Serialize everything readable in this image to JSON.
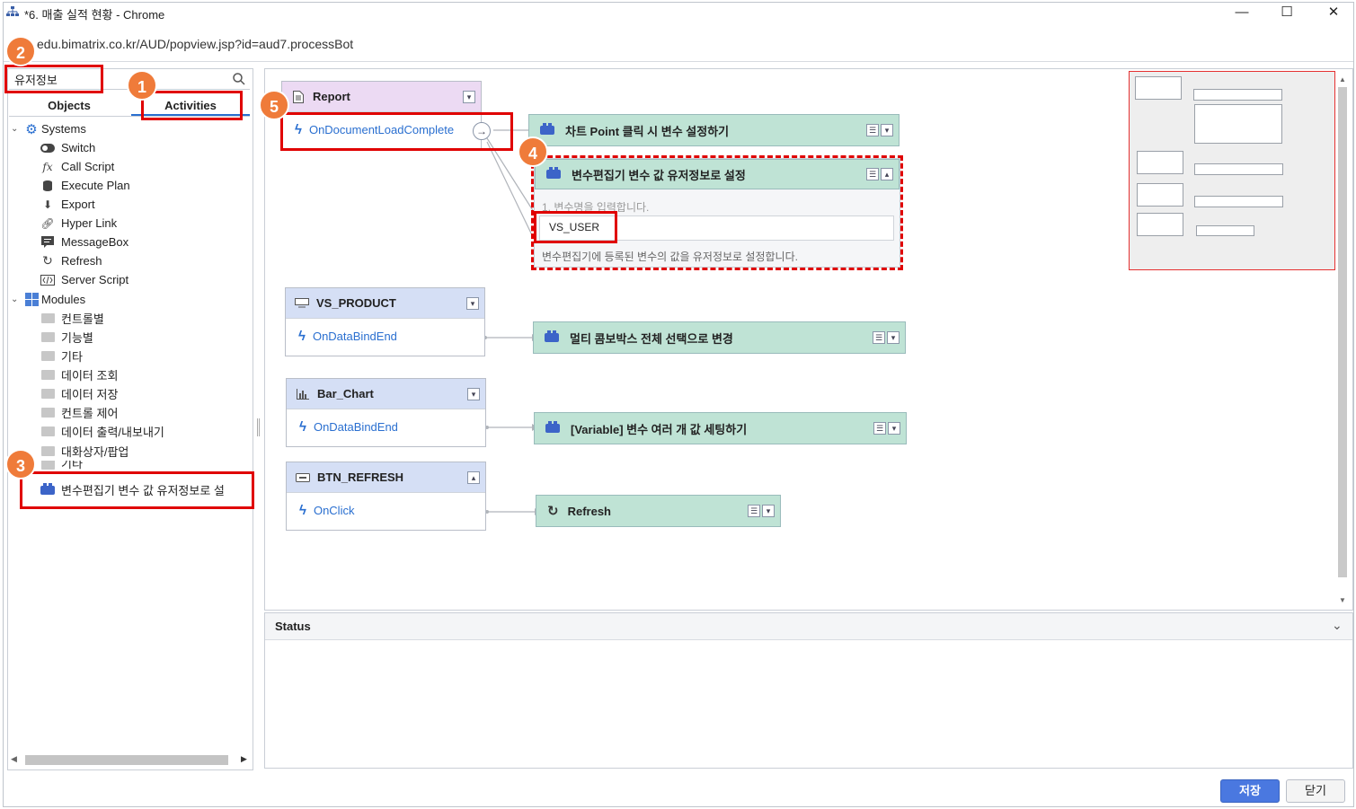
{
  "window": {
    "title": "*6. 매출 실적 현황 - Chrome",
    "url": "edu.bimatrix.co.kr/AUD/popview.jsp?id=aud7.processBot",
    "minimize": "—",
    "maximize": "☐",
    "close": "✕"
  },
  "left": {
    "search_value": "유저정보",
    "tabs": [
      "Objects",
      "Activities"
    ],
    "systems_label": "Systems",
    "systems_items": [
      "Switch",
      "Call Script",
      "Execute Plan",
      "Export",
      "Hyper Link",
      "MessageBox",
      "Refresh",
      "Server Script"
    ],
    "modules_label": "Modules",
    "modules_items": [
      "컨트롤별",
      "기능별",
      "기타",
      "데이터 조회",
      "데이터 저장",
      "컨트롤 제어",
      "데이터 출력/내보내기",
      "대화상자/팝업",
      "기타"
    ],
    "selected_item": "변수편집기 변수 값 유저정보로 설"
  },
  "canvas": {
    "sources": [
      {
        "name": "Report",
        "event": "OnDocumentLoadComplete"
      },
      {
        "name": "VS_PRODUCT",
        "event": "OnDataBindEnd"
      },
      {
        "name": "Bar_Chart",
        "event": "OnDataBindEnd"
      },
      {
        "name": "BTN_REFRESH",
        "event": "OnClick"
      }
    ],
    "actions": [
      {
        "label": "차트 Point 클릭 시 변수 설정하기"
      },
      {
        "label": "변수편집기 변수 값 유저정보로 설정"
      },
      {
        "label": "멀티 콤보박스 전체 선택으로 변경"
      },
      {
        "label": "[Variable] 변수 여러 개 값 세팅하기"
      },
      {
        "label": "Refresh"
      }
    ],
    "expanded": {
      "param_label": "1. 변수명을 입력합니다.",
      "param_value": "VS_USER",
      "description": "변수편집기에 등록된 변수의 값을 유저정보로 설정합니다."
    }
  },
  "status": {
    "title": "Status"
  },
  "buttons": {
    "save": "저장",
    "close": "닫기"
  },
  "badges": [
    "1",
    "2",
    "3",
    "4",
    "5"
  ],
  "colors": {
    "highlight": "#e00000",
    "badge": "#ef7b3a",
    "action_bg": "#bfe3d5",
    "report_head": "#ecdaf3",
    "source_head": "#d5dff5",
    "accent": "#2a6fd0"
  }
}
